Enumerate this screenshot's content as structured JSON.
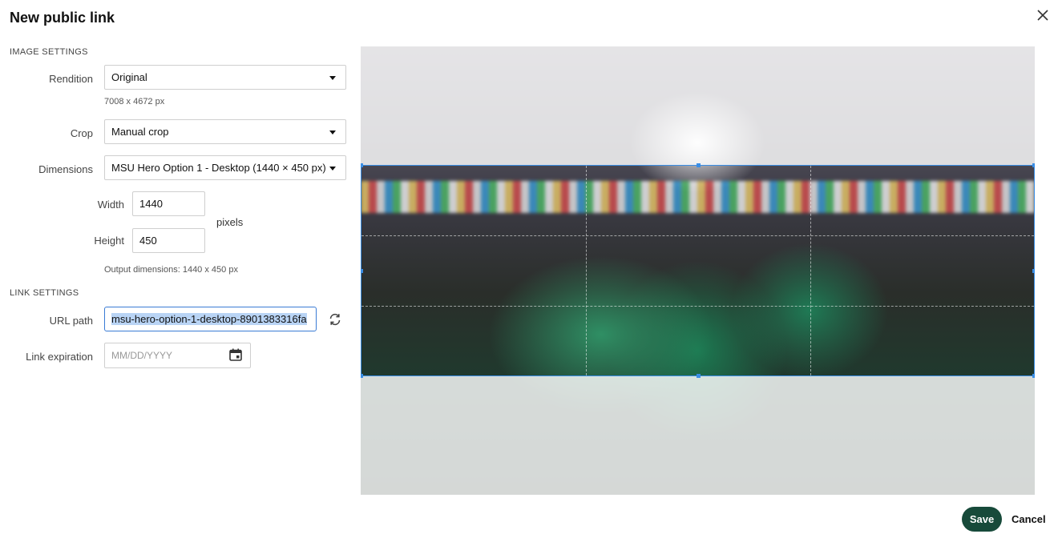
{
  "dialog": {
    "title": "New public link"
  },
  "image_settings": {
    "section_label": "IMAGE SETTINGS",
    "rendition": {
      "label": "Rendition",
      "value": "Original",
      "hint": "7008 x 4672 px"
    },
    "crop": {
      "label": "Crop",
      "value": "Manual crop"
    },
    "dimensions": {
      "label": "Dimensions",
      "value": "MSU Hero Option 1 - Desktop (1440 × 450 px)"
    },
    "width": {
      "label": "Width",
      "value": "1440"
    },
    "height": {
      "label": "Height",
      "value": "450"
    },
    "unit": "pixels",
    "output_hint": "Output dimensions: 1440 x 450 px"
  },
  "link_settings": {
    "section_label": "LINK SETTINGS",
    "url_path": {
      "label": "URL path",
      "value": "msu-hero-option-1-desktop-8901383316fa"
    },
    "expiration": {
      "label": "Link expiration",
      "placeholder": "MM/DD/YYYY"
    }
  },
  "footer": {
    "save_label": "Save",
    "cancel_label": "Cancel"
  },
  "colors": {
    "primary_button": "#174a3a",
    "crop_outline": "#3a8ee6",
    "focus_border": "#3a7bd5"
  },
  "icons": {
    "close": "close-icon",
    "refresh": "refresh-icon",
    "calendar": "calendar-icon",
    "dropdown": "chevron-down-icon"
  }
}
